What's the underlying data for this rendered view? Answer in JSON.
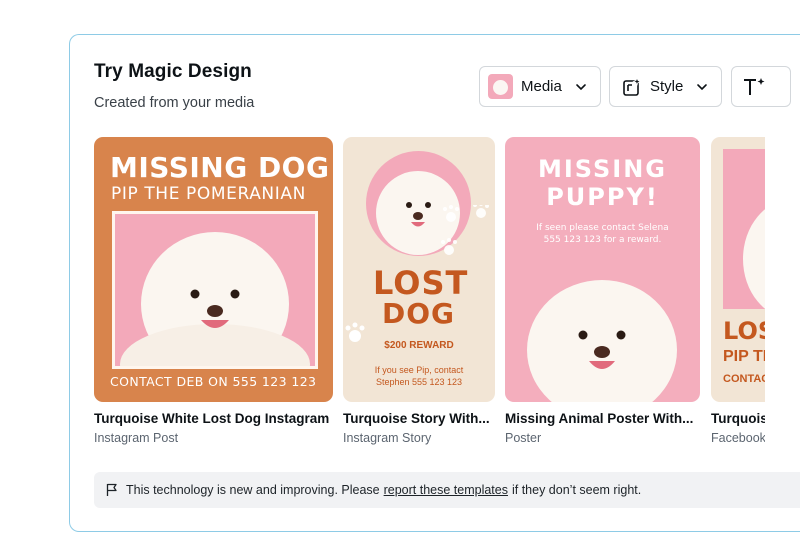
{
  "header": {
    "title": "Try Magic Design",
    "subtitle": "Created from your media"
  },
  "buttons": {
    "media_label": "Media",
    "style_label": "Style"
  },
  "cards": [
    {
      "title": "Turquoise White Lost Dog Instagram",
      "type": "Instagram Post",
      "poster": {
        "headline": "MISSING DOG",
        "subhead": "PIP THE POMERANIAN",
        "footer": "CONTACT DEB ON 555 123 123"
      }
    },
    {
      "title": "Turquoise Story With...",
      "type": "Instagram Story",
      "poster": {
        "headline_1": "LOST",
        "headline_2": "DOG",
        "reward": "$200 REWARD",
        "contact_1": "If you see Pip, contact",
        "contact_2": "Stephen 555 123 123"
      }
    },
    {
      "title": "Missing Animal Poster With...",
      "type": "Poster",
      "poster": {
        "headline_1": "MISSING",
        "headline_2": "PUPPY!",
        "contact_1": "If seen please contact Selena",
        "contact_2": "555 123 123 for a reward."
      }
    },
    {
      "title": "Turquois",
      "type": "Facebook",
      "poster": {
        "headline_1": "LOST",
        "headline_2": "PIP TH",
        "footer": "CONTACT"
      }
    }
  ],
  "notice": {
    "before": "This technology is new and improving. Please",
    "link": "report these templates",
    "after": "if they don’t seem right."
  },
  "colors": {
    "panel_border": "#8ecbe6",
    "orange": "#d8844c",
    "pink": "#f4aebd",
    "cream": "#f2e5d5",
    "rust": "#c4581f"
  }
}
